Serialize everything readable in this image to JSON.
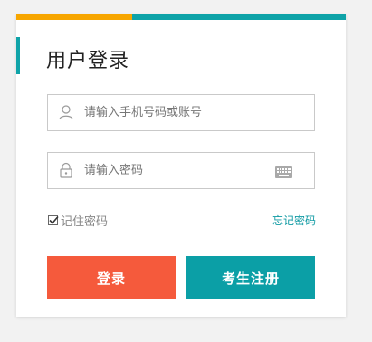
{
  "colors": {
    "accent_orange": "#f7a600",
    "accent_teal": "#0fa3a8",
    "login_button": "#f55a3c",
    "register_button": "#0b9fa6",
    "link": "#0f9aa3"
  },
  "login": {
    "title": "用户登录",
    "phone_field": {
      "placeholder": "请输入手机号码或账号",
      "value": "",
      "icon": "user-icon"
    },
    "password_field": {
      "placeholder": "请输入密码",
      "value": "",
      "icon": "lock-icon",
      "keyboard_icon": "keyboard-icon"
    },
    "remember_label": "记住密码",
    "remember_checked": true,
    "forgot_label": "忘记密码",
    "login_button": "登录",
    "register_button": "考生注册"
  }
}
